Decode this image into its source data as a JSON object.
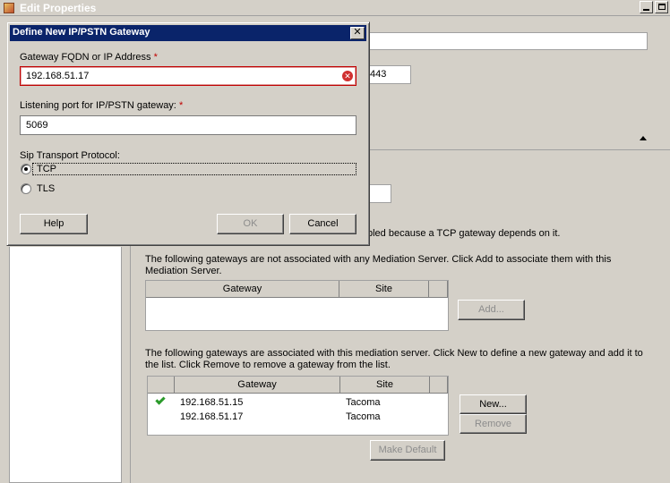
{
  "window": {
    "title": "Edit Properties"
  },
  "background": {
    "port_value": "443",
    "partial_text": "bled because a TCP gateway depends on it.",
    "unassociated_text": "The following gateways are not associated with any Mediation Server.  Click Add to associate them with this Mediation Server.",
    "unassociated_columns": [
      "Gateway",
      "Site"
    ],
    "add_button": "Add...",
    "associated_text": "The following gateways are associated with this mediation server.  Click New to define a new gateway and add it to the list.  Click Remove to remove a gateway from the list.",
    "associated_columns": [
      "Gateway",
      "Site"
    ],
    "associated_rows": [
      {
        "gateway": "192.168.51.15",
        "site": "Tacoma",
        "default": true
      },
      {
        "gateway": "192.168.51.17",
        "site": "Tacoma",
        "default": false
      }
    ],
    "new_button": "New...",
    "remove_button": "Remove",
    "make_default_button": "Make Default"
  },
  "dialog": {
    "title": "Define New IP/PSTN Gateway",
    "close_glyph": "✕",
    "fqdn_label": "Gateway FQDN or IP Address",
    "fqdn_value": "192.168.51.17",
    "required_marker": "*",
    "port_label": "Listening port for IP/PSTN gateway:",
    "port_value": "5069",
    "protocol_label": "Sip Transport Protocol:",
    "protocol_options": [
      "TCP",
      "TLS"
    ],
    "protocol_selected": "TCP",
    "help_button": "Help",
    "ok_button": "OK",
    "cancel_button": "Cancel",
    "error_glyph": "✕"
  },
  "colors": {
    "title_active": "#0a246a",
    "error": "#c00000",
    "check": "#2a9a2a"
  }
}
